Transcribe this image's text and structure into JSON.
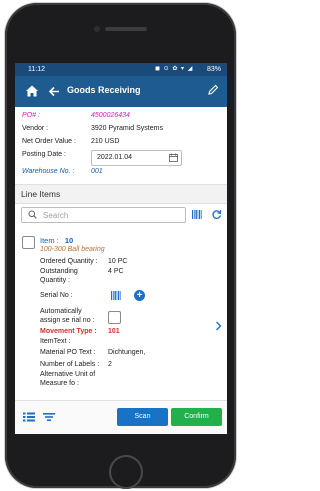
{
  "status_bar": {
    "time": "11:12",
    "icons": "◼ ⊙ ✿ ▾ ◢",
    "battery": "83%"
  },
  "app_bar": {
    "title": "Goods Receiving",
    "icons": [
      "home-icon",
      "back-arrow-icon",
      "edit-icon"
    ]
  },
  "header": {
    "po_label": "PO# :",
    "po_value": "4500026434",
    "vendor_label": "Vendor :",
    "vendor_value": "3920 Pyramid Systems",
    "net_order_label": "Net Order Value :",
    "net_order_value": "210 USD",
    "posting_date_label": "Posting Date :",
    "posting_date_value": "2022.01.04",
    "warehouse_label": "Warehouse No. :",
    "warehouse_value": "001"
  },
  "line_items_section": {
    "title": "Line Items",
    "search_placeholder": "Search"
  },
  "line_item": {
    "item_label": "Item :",
    "item_number": "10",
    "description": "100-300 Ball bearing",
    "ordered_qty_label": "Ordered Quantity :",
    "ordered_qty_value": "10 PC",
    "outstanding_qty_label_1": "Outstanding",
    "outstanding_qty_label_2": "Quantity :",
    "outstanding_qty_value": "4 PC",
    "serial_no_label": "Serial No :",
    "auto_serial_label_1": "Automatically",
    "auto_serial_label_2": "assign se rial no :",
    "movement_type_label": "Movement Type :",
    "movement_type_value": "101",
    "item_text_label": "ItemText :",
    "material_po_text_label": "Material PO Text :",
    "material_po_text_value": "Dichtungen,",
    "number_of_labels_label": "Number of Labels :",
    "number_of_labels_value": "2",
    "alt_unit_label_1": "Alternative Unit of",
    "alt_unit_label_2": "Measure fo :"
  },
  "bottom_bar": {
    "scan_label": "Scan",
    "confirm_label": "Confirm"
  },
  "colors": {
    "app_bar": "#1e5b91",
    "status_bar": "#1a4a7a",
    "po_magenta": "#d11bb5",
    "movement_red": "#d32f2f",
    "scan_blue": "#1873c7",
    "confirm_green": "#21b04b"
  }
}
